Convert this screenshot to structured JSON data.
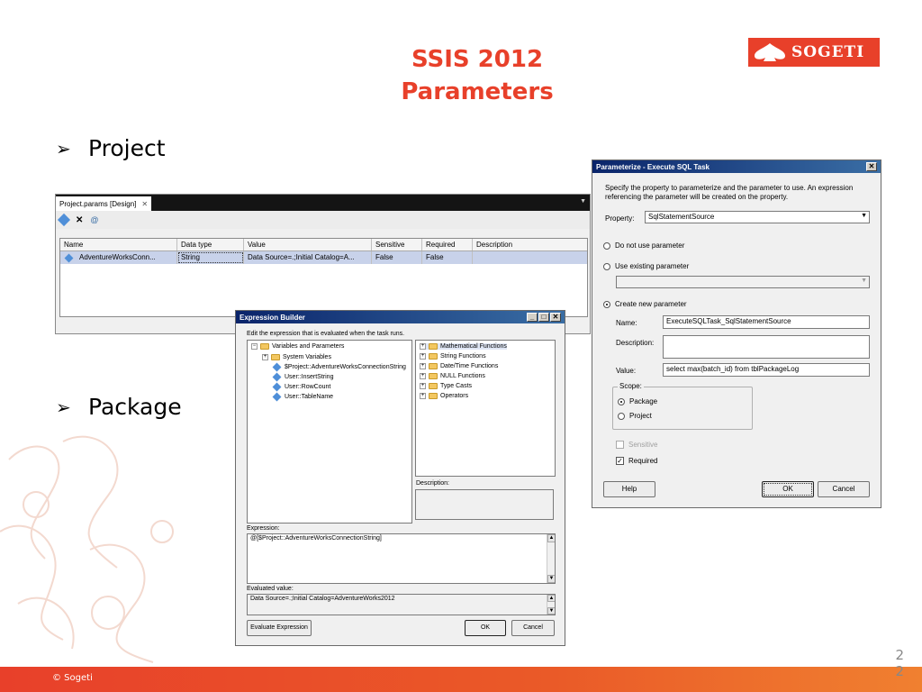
{
  "slide": {
    "title_line1": "SSIS 2012",
    "title_line2": "Parameters",
    "logo_text": "SOGETI",
    "bullet1": "Project",
    "bullet2": "Package",
    "footer": "© Sogeti",
    "page_number": "2",
    "page_number2": "2",
    "colors": {
      "accent": "#e8402a",
      "footer": "#ea5a28"
    }
  },
  "project_params": {
    "tab_label": "Project.params [Design]",
    "columns": [
      "Name",
      "Data type",
      "Value",
      "Sensitive",
      "Required",
      "Description"
    ],
    "rows": [
      {
        "name": "AdventureWorksConn...",
        "data_type": "String",
        "value": "Data Source=.;Initial Catalog=A...",
        "sensitive": "False",
        "required": "False",
        "description": ""
      }
    ],
    "toolbar_icons": [
      "add-parameter-icon",
      "delete-icon",
      "add-to-config-icon"
    ]
  },
  "expression_builder": {
    "title": "Expression Builder",
    "instruction": "Edit the expression that is evaluated when the task runs.",
    "left_tree": {
      "root": "Variables and Parameters",
      "system": "System Variables",
      "items": [
        "$Project::AdventureWorksConnectionString",
        "User::InsertString",
        "User::RowCount",
        "User::TableName"
      ]
    },
    "right_tree": [
      "Mathematical Functions",
      "String Functions",
      "Date/Time Functions",
      "NULL Functions",
      "Type Casts",
      "Operators"
    ],
    "description_label": "Description:",
    "expression_label": "Expression:",
    "expression_value": "@[$Project::AdventureWorksConnectionString]",
    "evaluated_label": "Evaluated value:",
    "evaluated_value": "Data Source=.;Initial Catalog=AdventureWorks2012",
    "evaluate_button": "Evaluate Expression",
    "ok_button": "OK",
    "cancel_button": "Cancel"
  },
  "parameterize": {
    "title": "Parameterize - Execute SQL Task",
    "intro": "Specify the property to parameterize and the parameter to use. An expression referencing the parameter will be created on the property.",
    "property_label": "Property:",
    "property_value": "SqlStatementSource",
    "opt_no_param": "Do not use parameter",
    "opt_existing": "Use existing parameter",
    "opt_new": "Create new parameter",
    "name_label": "Name:",
    "name_value": "ExecuteSQLTask_SqlStatementSource",
    "desc_label": "Description:",
    "desc_value": "",
    "value_label": "Value:",
    "value_value": "select max(batch_id) from tblPackageLog",
    "scope_label": "Scope:",
    "scope_package": "Package",
    "scope_project": "Project",
    "sensitive_label": "Sensitive",
    "required_label": "Required",
    "help_button": "Help",
    "ok_button": "OK",
    "cancel_button": "Cancel",
    "close_glyph": "✕"
  }
}
